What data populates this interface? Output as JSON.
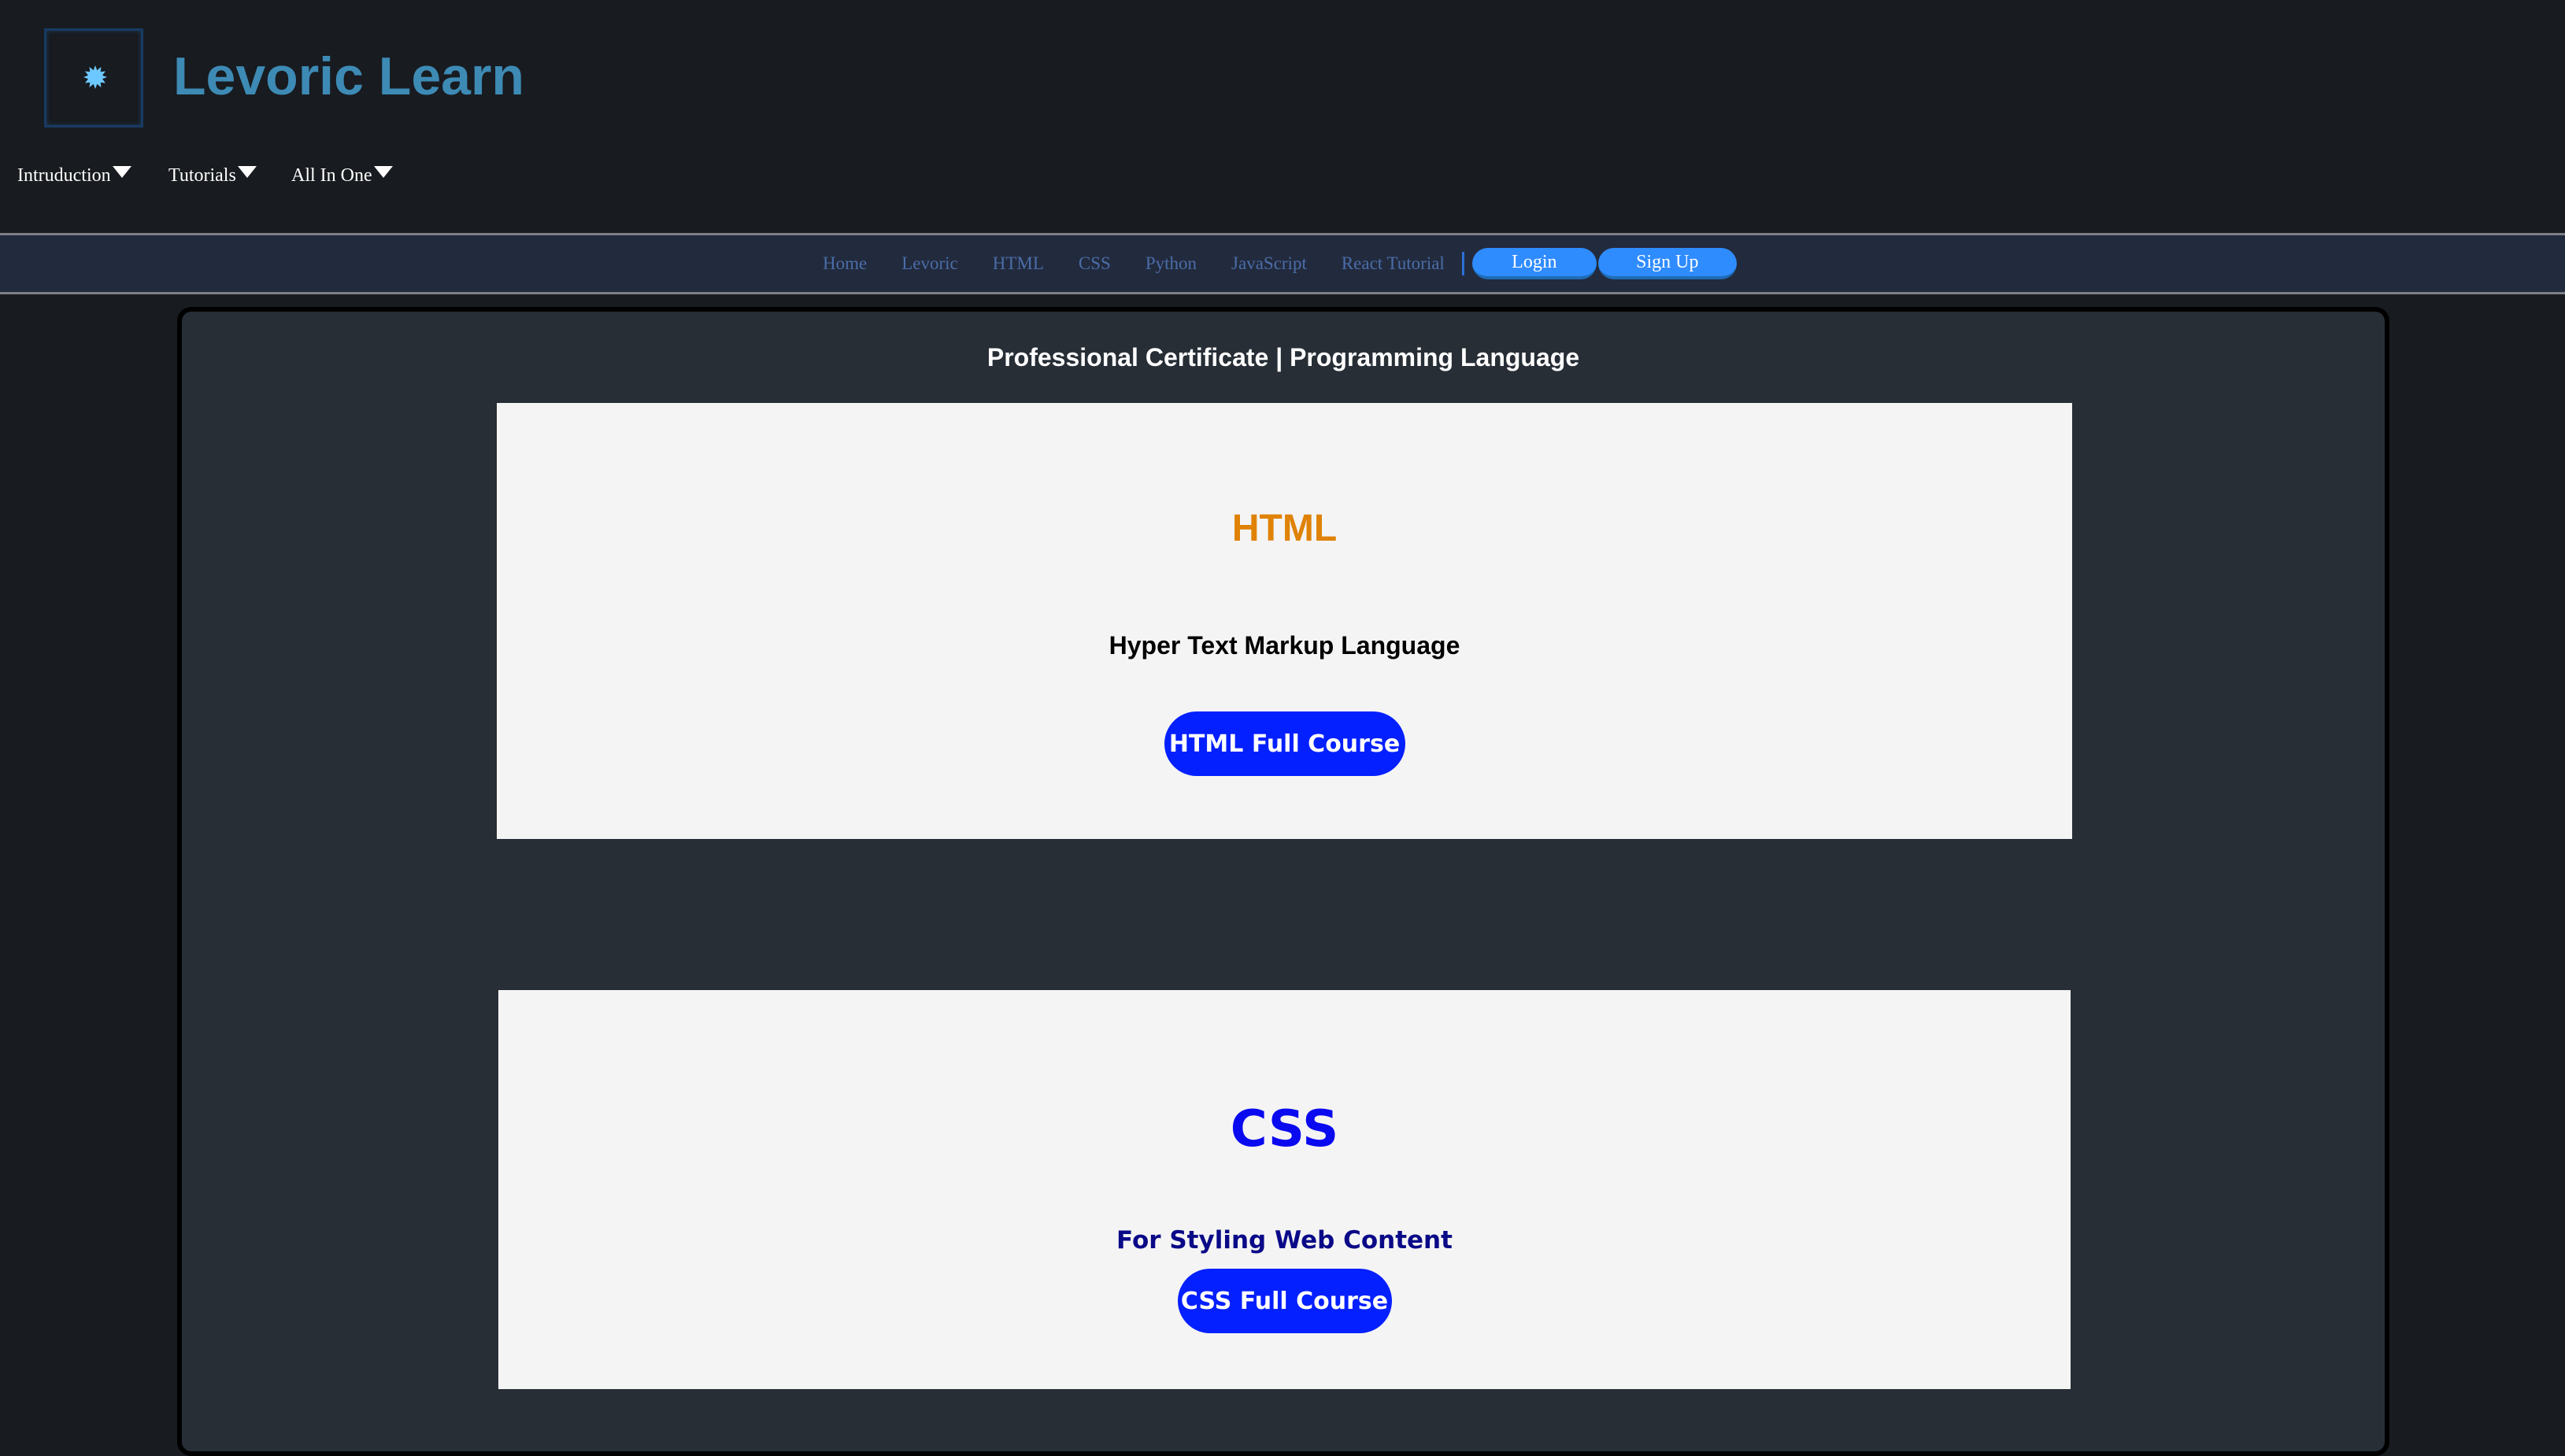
{
  "brand": {
    "name": "Levoric Learn",
    "logo_icon": "sun-star-icon",
    "accent": "#3d8ab5"
  },
  "dropdowns": [
    {
      "label": "Intruduction"
    },
    {
      "label": "Tutorials"
    },
    {
      "label": "All In One"
    }
  ],
  "navbar": {
    "links": [
      "Home",
      "Levoric",
      "HTML",
      "CSS",
      "Python",
      "JavaScript",
      "React Tutorial"
    ],
    "login_label": "Login",
    "signup_label": "Sign Up"
  },
  "main": {
    "section_title": "Professional Certificate | Programming Language",
    "cards": [
      {
        "title": "HTML",
        "subtitle": "Hyper Text Markup Language",
        "button": "HTML Full Course",
        "title_color": "#df8206"
      },
      {
        "title": "CSS",
        "subtitle": "For Styling Web Content",
        "button": "CSS Full Course",
        "title_color": "#0a0af0"
      }
    ]
  }
}
